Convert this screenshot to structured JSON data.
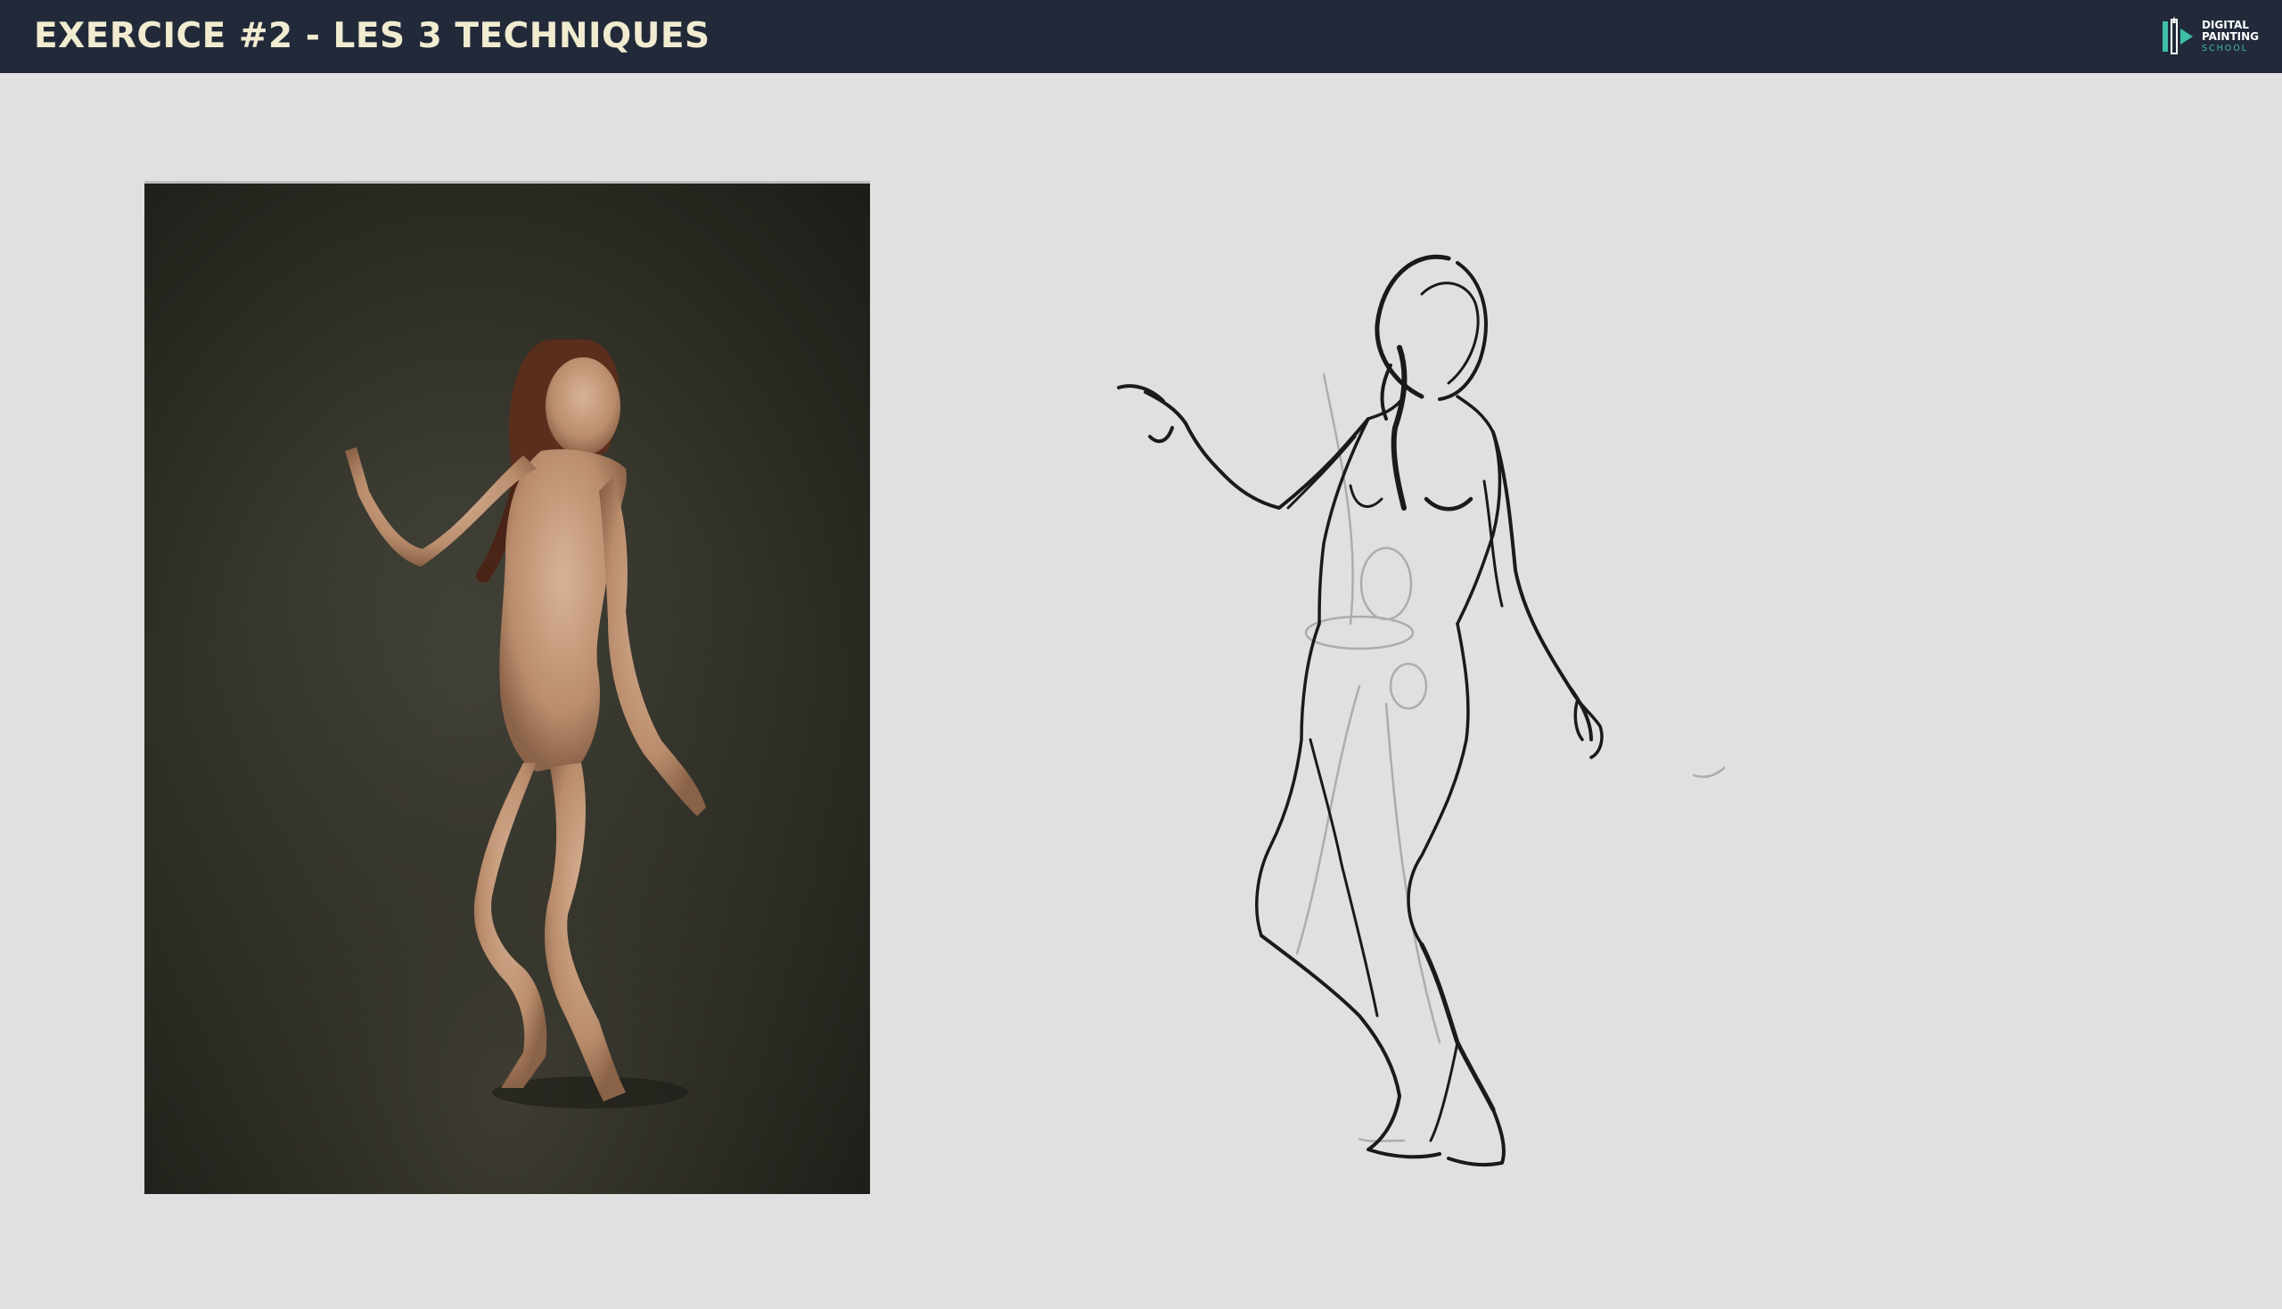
{
  "header": {
    "title": "EXERCICE #2 - LES 3 TECHNIQUES",
    "background_color": "#222a3a",
    "title_color": "#f1ecd0"
  },
  "logo": {
    "line1": "DIGITAL",
    "line2": "PAINTING",
    "line3": "SCHOOL",
    "accent_color": "#3fbfa6",
    "icon": "brush-logo-icon"
  },
  "canvas": {
    "background_color": "#e0e0e0"
  },
  "reference_photo": {
    "icon": "reference-photo-image",
    "background_color": "#34342b",
    "skin_color": "#c9a184"
  },
  "gesture_sketch": {
    "icon": "figure-sketch-image",
    "line_color": "#1a1a1a",
    "construction_color": "#9a9a9a"
  }
}
